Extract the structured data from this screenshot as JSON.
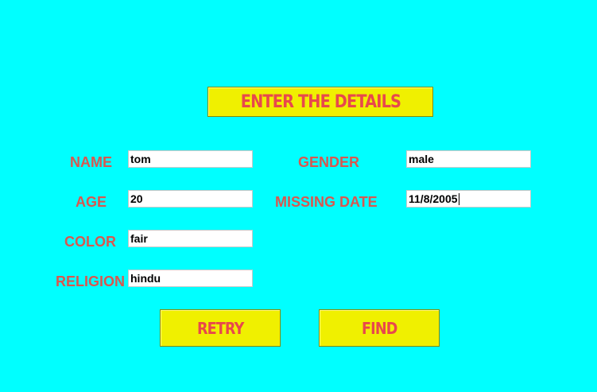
{
  "header": {
    "title": "ENTER THE DETAILS"
  },
  "form": {
    "name_label": "NAME",
    "name_value": "tom",
    "age_label": "AGE",
    "age_value": "20",
    "color_label": "COLOR",
    "color_value": "fair",
    "religion_label": "RELIGION",
    "religion_value": "hindu",
    "gender_label": "GENDER",
    "gender_value": "male",
    "missing_date_label": "MISSING DATE",
    "missing_date_value": "11/8/2005"
  },
  "buttons": {
    "retry_label": "RETRY",
    "find_label": "FIND"
  },
  "colors": {
    "background": "#00ffff",
    "button_fill": "#f0f000",
    "label_text": "#d9574f",
    "button_text": "#e8484c"
  }
}
